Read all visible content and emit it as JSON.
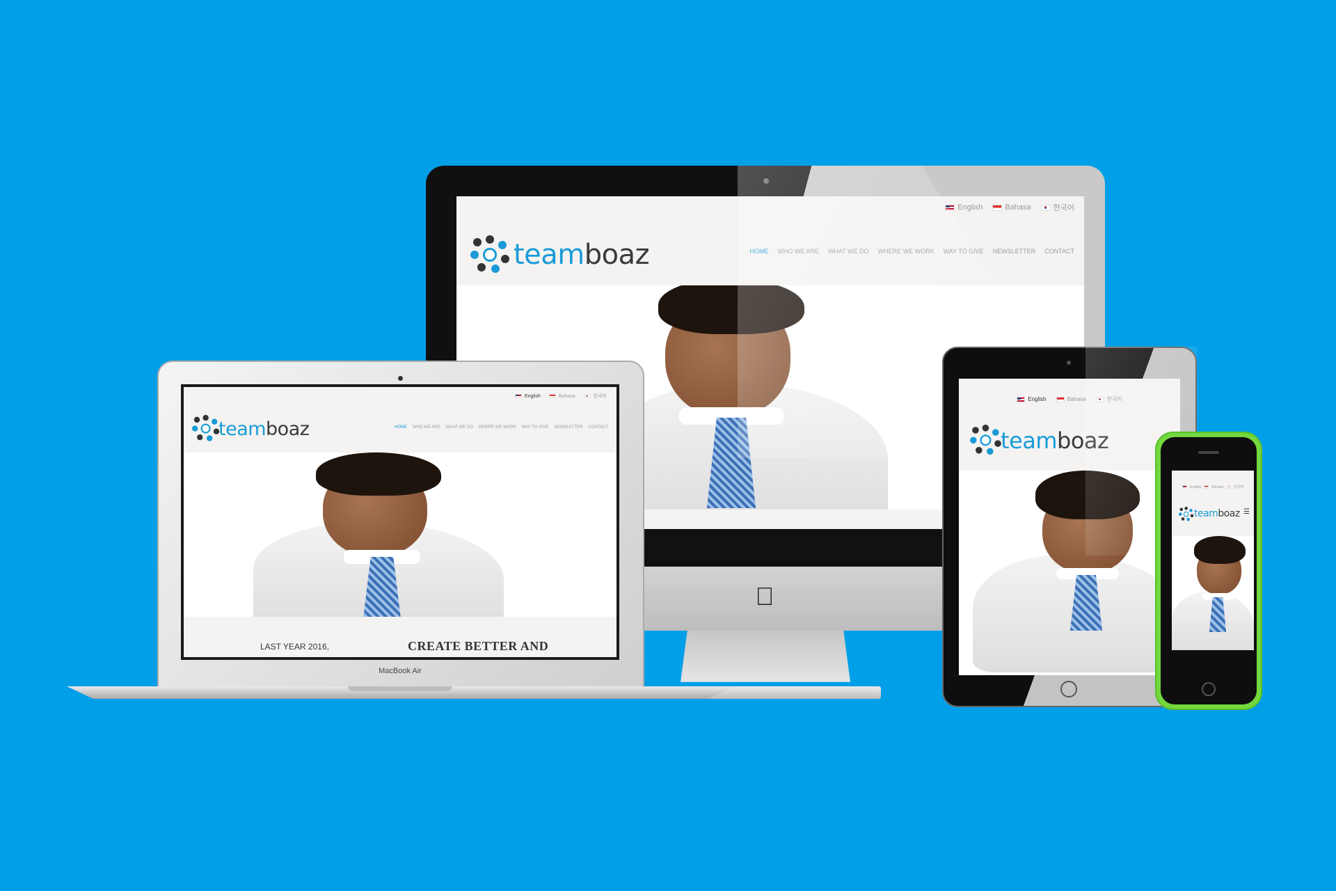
{
  "background_color": "#019fe8",
  "site": {
    "logo": {
      "part1": "team",
      "part2": "boaz"
    },
    "languages": [
      {
        "label": "English",
        "flag": "us-flag-icon"
      },
      {
        "label": "Bahasa",
        "flag": "indonesia-flag-icon"
      },
      {
        "label": "한국어",
        "flag": "korea-flag-icon"
      }
    ],
    "nav": [
      "HOME",
      "WHO WE ARE",
      "WHAT WE DO",
      "WHERE WE WORK",
      "WAY TO GIVE",
      "NEWSLETTER",
      "CONTACT"
    ],
    "active_nav": "HOME",
    "intro_left": "LAST YEAR 2016,",
    "intro_heading": "CREATE BETTER AND",
    "menu_icon": "☰"
  },
  "devices": {
    "laptop_label": "MacBook Air",
    "imac_logo": "apple-logo-icon"
  },
  "colors": {
    "brand_blue": "#1a9bd7",
    "brand_dark": "#3a3a3a",
    "phone_green": "#72d83e"
  }
}
